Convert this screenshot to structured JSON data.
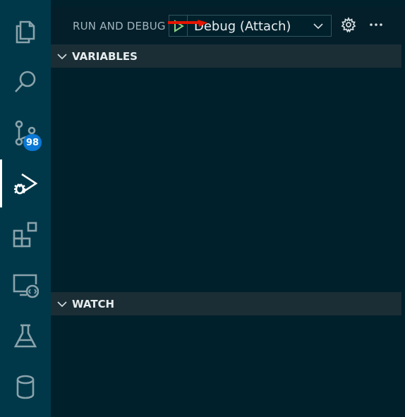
{
  "activity_bar": {
    "items": [
      {
        "name": "explorer",
        "icon": "files-icon"
      },
      {
        "name": "search",
        "icon": "search-icon"
      },
      {
        "name": "source-control",
        "icon": "source-control-icon",
        "badge": "98"
      },
      {
        "name": "run-and-debug",
        "icon": "debug-icon",
        "active": true
      },
      {
        "name": "extensions",
        "icon": "extensions-icon"
      },
      {
        "name": "remote-explorer",
        "icon": "remote-explorer-icon"
      },
      {
        "name": "testing",
        "icon": "flask-icon"
      },
      {
        "name": "database",
        "icon": "database-icon"
      }
    ]
  },
  "header": {
    "title": "RUN AND DEBUG",
    "config_label": "Debug (Attach)"
  },
  "sections": {
    "variables": {
      "label": "VARIABLES"
    },
    "watch": {
      "label": "WATCH"
    }
  },
  "colors": {
    "accent_green": "#89d185",
    "arrow_red": "#e51400",
    "badge_blue": "#0a78d4"
  }
}
